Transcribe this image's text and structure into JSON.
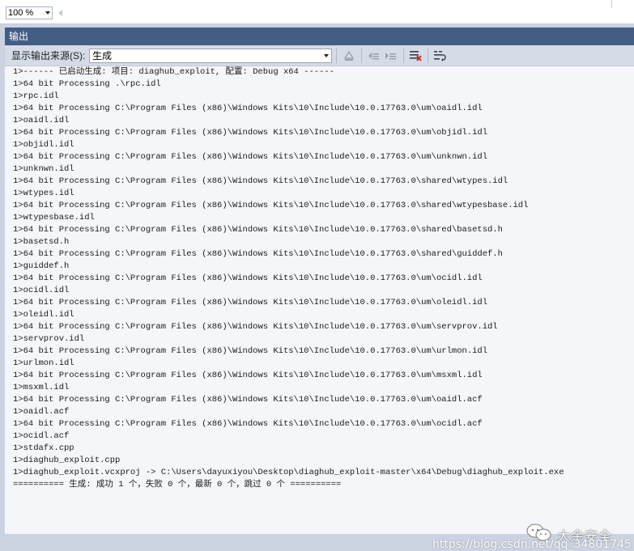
{
  "editor": {
    "zoom": "100 %"
  },
  "pane": {
    "title": "输出",
    "source_label": "显示输出来源(S):",
    "source_value": "生成"
  },
  "icons": {
    "find_message": "find-message-icon",
    "prev_message": "previous-message-icon",
    "next_message": "next-message-icon",
    "clear_all": "clear-all-icon",
    "word_wrap": "word-wrap-icon"
  },
  "colors": {
    "title_bar": "#435d85",
    "toolbar": "#d5dbe7",
    "clear_icon": "#c8262b"
  },
  "output_lines": [
    "1>------ 已启动生成: 项目: diaghub_exploit, 配置: Debug x64 ------",
    "1>64 bit Processing .\\rpc.idl",
    "1>rpc.idl",
    "1>64 bit Processing C:\\Program Files (x86)\\Windows Kits\\10\\Include\\10.0.17763.0\\um\\oaidl.idl",
    "1>oaidl.idl",
    "1>64 bit Processing C:\\Program Files (x86)\\Windows Kits\\10\\Include\\10.0.17763.0\\um\\objidl.idl",
    "1>objidl.idl",
    "1>64 bit Processing C:\\Program Files (x86)\\Windows Kits\\10\\Include\\10.0.17763.0\\um\\unknwn.idl",
    "1>unknwn.idl",
    "1>64 bit Processing C:\\Program Files (x86)\\Windows Kits\\10\\Include\\10.0.17763.0\\shared\\wtypes.idl",
    "1>wtypes.idl",
    "1>64 bit Processing C:\\Program Files (x86)\\Windows Kits\\10\\Include\\10.0.17763.0\\shared\\wtypesbase.idl",
    "1>wtypesbase.idl",
    "1>64 bit Processing C:\\Program Files (x86)\\Windows Kits\\10\\Include\\10.0.17763.0\\shared\\basetsd.h",
    "1>basetsd.h",
    "1>64 bit Processing C:\\Program Files (x86)\\Windows Kits\\10\\Include\\10.0.17763.0\\shared\\guiddef.h",
    "1>guiddef.h",
    "1>64 bit Processing C:\\Program Files (x86)\\Windows Kits\\10\\Include\\10.0.17763.0\\um\\ocidl.idl",
    "1>ocidl.idl",
    "1>64 bit Processing C:\\Program Files (x86)\\Windows Kits\\10\\Include\\10.0.17763.0\\um\\oleidl.idl",
    "1>oleidl.idl",
    "1>64 bit Processing C:\\Program Files (x86)\\Windows Kits\\10\\Include\\10.0.17763.0\\um\\servprov.idl",
    "1>servprov.idl",
    "1>64 bit Processing C:\\Program Files (x86)\\Windows Kits\\10\\Include\\10.0.17763.0\\um\\urlmon.idl",
    "1>urlmon.idl",
    "1>64 bit Processing C:\\Program Files (x86)\\Windows Kits\\10\\Include\\10.0.17763.0\\um\\msxml.idl",
    "1>msxml.idl",
    "1>64 bit Processing C:\\Program Files (x86)\\Windows Kits\\10\\Include\\10.0.17763.0\\um\\oaidl.acf",
    "1>oaidl.acf",
    "1>64 bit Processing C:\\Program Files (x86)\\Windows Kits\\10\\Include\\10.0.17763.0\\um\\ocidl.acf",
    "1>ocidl.acf",
    "1>stdafx.cpp",
    "1>diaghub_exploit.cpp",
    "1>diaghub_exploit.vcxproj -> C:\\Users\\dayuxiyou\\Desktop\\diaghub_exploit-master\\x64\\Debug\\diaghub_exploit.exe",
    "========== 生成: 成功 1 个，失败 0 个，最新 0 个，跳过 0 个 =========="
  ],
  "watermark": {
    "brand": "大余安全",
    "url": "https://blog.csdn.net/qq_34801745"
  }
}
